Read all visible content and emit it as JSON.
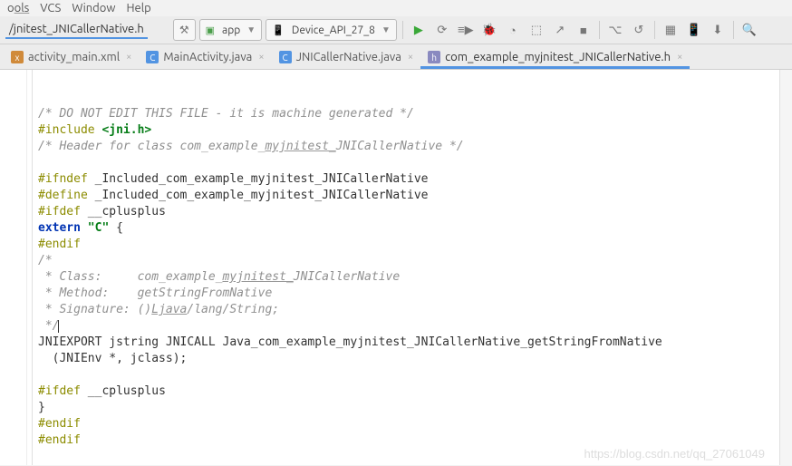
{
  "menubar": {
    "items": [
      "ols",
      "VCS",
      "Window",
      "Help"
    ]
  },
  "toolbar": {
    "nav_file": "/jnitest_JNICallerNative.h",
    "run_config": "app",
    "device": "Device_API_27_8",
    "icons": [
      "play",
      "apply",
      "stop",
      "debug",
      "profile",
      "attach",
      "layout",
      "git",
      "sync",
      "avd",
      "sdk",
      "settings",
      "search"
    ]
  },
  "tabs": [
    {
      "label": "activity_main.xml",
      "type": "xml",
      "active": false
    },
    {
      "label": "MainActivity.java",
      "type": "java",
      "active": false
    },
    {
      "label": "JNICallerNative.java",
      "type": "java",
      "active": false
    },
    {
      "label": "com_example_myjnitest_JNICallerNative.h",
      "type": "h",
      "active": true
    }
  ],
  "code": {
    "l1": "/* DO NOT EDIT THIS FILE - it is machine generated */",
    "l2_a": "#include ",
    "l2_b": "<jni.h>",
    "l3_a": "/* Header for class com_example_",
    "l3_b": "myjnitest_",
    "l3_c": "JNICallerNative */",
    "l5_a": "#ifndef ",
    "l5_b": "_Included_com_example_myjnitest_JNICallerNative",
    "l6_a": "#define ",
    "l6_b": "_Included_com_example_myjnitest_JNICallerNative",
    "l7_a": "#ifdef ",
    "l7_b": "__cplusplus",
    "l8_a": "extern ",
    "l8_b": "\"C\"",
    "l8_c": " {",
    "l9": "#endif",
    "l10": "/*",
    "l11_a": " * Class:     com_example_",
    "l11_b": "myjnitest_",
    "l11_c": "JNICallerNative",
    "l12": " * Method:    getStringFromNative",
    "l13_a": " * Signature: ()",
    "l13_b": "Ljava",
    "l13_c": "/lang/String;",
    "l14": " */",
    "l15": "JNIEXPORT jstring JNICALL Java_com_example_myjnitest_JNICallerNative_getStringFromNative",
    "l16": "  (JNIEnv *, jclass);",
    "l18_a": "#ifdef ",
    "l18_b": "__cplusplus",
    "l19": "}",
    "l20": "#endif",
    "l21": "#endif"
  },
  "watermark": "https://blog.csdn.net/qq_27061049"
}
